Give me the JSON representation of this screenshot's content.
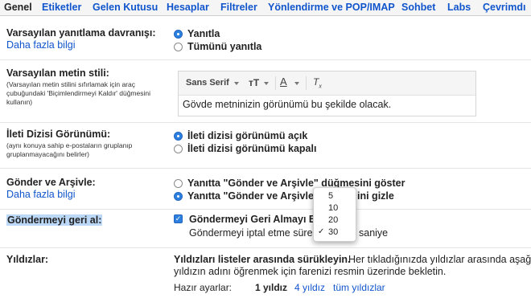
{
  "tabs": [
    {
      "label": "Genel",
      "active": true
    },
    {
      "label": "Etiketler"
    },
    {
      "label": "Gelen Kutusu"
    },
    {
      "label": "Hesaplar"
    },
    {
      "label": "Filtreler"
    },
    {
      "label": "Yönlendirme ve POP/IMAP"
    },
    {
      "label": "Sohbet"
    },
    {
      "label": "Labs"
    },
    {
      "label": "Çevrimdı"
    }
  ],
  "reply": {
    "label": "Varsayılan yanıtlama davranışı:",
    "link": "Daha fazla bilgi",
    "options": [
      "Yanıtla",
      "Tümünü yanıtla"
    ]
  },
  "text_style": {
    "label": "Varsayılan metin stili:",
    "note": "(Varsayılan metin stilini sıfırlamak için araç çubuğundaki 'Biçimlendirmeyi Kaldır' düğmesini kullanın)",
    "font": "Sans Serif",
    "size_icon": "text-size-icon",
    "color_icon": "text-color-icon",
    "clear_icon": "remove-formatting-icon",
    "preview": "Gövde metninizin görünümü bu şekilde olacak."
  },
  "thread": {
    "label": "İleti Dizisi Görünümü:",
    "note": "(aynı konuya sahip e-postaların gruplanıp gruplanmayacağını belirler)",
    "options": [
      "İleti dizisi görünümü açık",
      "İleti dizisi görünümü kapalı"
    ]
  },
  "send_archive": {
    "label": "Gönder ve Arşivle:",
    "link": "Daha fazla bilgi",
    "option1": "Yanıtta \"Gönder ve Arşivle\" düğmesini göster",
    "option2_a": "Yanıtta \"Gönder ve Arşivle\"",
    "option2_b": "ini gizle"
  },
  "undo_send": {
    "label": "Göndermeyi geri al:",
    "checkbox": "Göndermeyi Geri Almayı Et",
    "period_a": "Göndermeyi iptal etme süresi",
    "period_b": "saniye",
    "options": [
      "5",
      "10",
      "20",
      "30"
    ],
    "selected": "30",
    "check_mark": "✓"
  },
  "stars": {
    "label": "Yıldızlar:",
    "desc_bold": "Yıldızları listeler arasında sürükleyin.",
    "desc_1": "Her tıkladığınızda yıldızlar arasında aşağıd",
    "desc_2": "yıldızın adını öğrenmek için farenizi resmin üzerinde bekletin.",
    "presets_label": "Hazır ayarlar:",
    "presets": [
      "1 yıldız",
      "4 yıldız",
      "tüm yıldızlar"
    ]
  },
  "colors": {
    "link": "#1155cc",
    "accent": "#2d7fe0"
  }
}
